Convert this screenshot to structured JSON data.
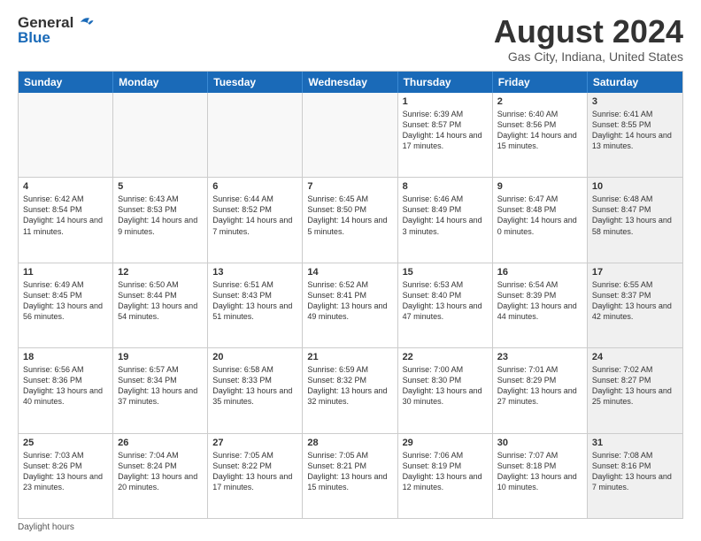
{
  "header": {
    "logo_general": "General",
    "logo_blue": "Blue",
    "title": "August 2024",
    "subtitle": "Gas City, Indiana, United States"
  },
  "days": [
    "Sunday",
    "Monday",
    "Tuesday",
    "Wednesday",
    "Thursday",
    "Friday",
    "Saturday"
  ],
  "weeks": [
    [
      {
        "num": "",
        "text": "",
        "empty": true
      },
      {
        "num": "",
        "text": "",
        "empty": true
      },
      {
        "num": "",
        "text": "",
        "empty": true
      },
      {
        "num": "",
        "text": "",
        "empty": true
      },
      {
        "num": "1",
        "text": "Sunrise: 6:39 AM\nSunset: 8:57 PM\nDaylight: 14 hours and 17 minutes.",
        "empty": false
      },
      {
        "num": "2",
        "text": "Sunrise: 6:40 AM\nSunset: 8:56 PM\nDaylight: 14 hours and 15 minutes.",
        "empty": false
      },
      {
        "num": "3",
        "text": "Sunrise: 6:41 AM\nSunset: 8:55 PM\nDaylight: 14 hours and 13 minutes.",
        "empty": false,
        "shaded": true
      }
    ],
    [
      {
        "num": "4",
        "text": "Sunrise: 6:42 AM\nSunset: 8:54 PM\nDaylight: 14 hours and 11 minutes.",
        "empty": false
      },
      {
        "num": "5",
        "text": "Sunrise: 6:43 AM\nSunset: 8:53 PM\nDaylight: 14 hours and 9 minutes.",
        "empty": false
      },
      {
        "num": "6",
        "text": "Sunrise: 6:44 AM\nSunset: 8:52 PM\nDaylight: 14 hours and 7 minutes.",
        "empty": false
      },
      {
        "num": "7",
        "text": "Sunrise: 6:45 AM\nSunset: 8:50 PM\nDaylight: 14 hours and 5 minutes.",
        "empty": false
      },
      {
        "num": "8",
        "text": "Sunrise: 6:46 AM\nSunset: 8:49 PM\nDaylight: 14 hours and 3 minutes.",
        "empty": false
      },
      {
        "num": "9",
        "text": "Sunrise: 6:47 AM\nSunset: 8:48 PM\nDaylight: 14 hours and 0 minutes.",
        "empty": false
      },
      {
        "num": "10",
        "text": "Sunrise: 6:48 AM\nSunset: 8:47 PM\nDaylight: 13 hours and 58 minutes.",
        "empty": false,
        "shaded": true
      }
    ],
    [
      {
        "num": "11",
        "text": "Sunrise: 6:49 AM\nSunset: 8:45 PM\nDaylight: 13 hours and 56 minutes.",
        "empty": false
      },
      {
        "num": "12",
        "text": "Sunrise: 6:50 AM\nSunset: 8:44 PM\nDaylight: 13 hours and 54 minutes.",
        "empty": false
      },
      {
        "num": "13",
        "text": "Sunrise: 6:51 AM\nSunset: 8:43 PM\nDaylight: 13 hours and 51 minutes.",
        "empty": false
      },
      {
        "num": "14",
        "text": "Sunrise: 6:52 AM\nSunset: 8:41 PM\nDaylight: 13 hours and 49 minutes.",
        "empty": false
      },
      {
        "num": "15",
        "text": "Sunrise: 6:53 AM\nSunset: 8:40 PM\nDaylight: 13 hours and 47 minutes.",
        "empty": false
      },
      {
        "num": "16",
        "text": "Sunrise: 6:54 AM\nSunset: 8:39 PM\nDaylight: 13 hours and 44 minutes.",
        "empty": false
      },
      {
        "num": "17",
        "text": "Sunrise: 6:55 AM\nSunset: 8:37 PM\nDaylight: 13 hours and 42 minutes.",
        "empty": false,
        "shaded": true
      }
    ],
    [
      {
        "num": "18",
        "text": "Sunrise: 6:56 AM\nSunset: 8:36 PM\nDaylight: 13 hours and 40 minutes.",
        "empty": false
      },
      {
        "num": "19",
        "text": "Sunrise: 6:57 AM\nSunset: 8:34 PM\nDaylight: 13 hours and 37 minutes.",
        "empty": false
      },
      {
        "num": "20",
        "text": "Sunrise: 6:58 AM\nSunset: 8:33 PM\nDaylight: 13 hours and 35 minutes.",
        "empty": false
      },
      {
        "num": "21",
        "text": "Sunrise: 6:59 AM\nSunset: 8:32 PM\nDaylight: 13 hours and 32 minutes.",
        "empty": false
      },
      {
        "num": "22",
        "text": "Sunrise: 7:00 AM\nSunset: 8:30 PM\nDaylight: 13 hours and 30 minutes.",
        "empty": false
      },
      {
        "num": "23",
        "text": "Sunrise: 7:01 AM\nSunset: 8:29 PM\nDaylight: 13 hours and 27 minutes.",
        "empty": false
      },
      {
        "num": "24",
        "text": "Sunrise: 7:02 AM\nSunset: 8:27 PM\nDaylight: 13 hours and 25 minutes.",
        "empty": false,
        "shaded": true
      }
    ],
    [
      {
        "num": "25",
        "text": "Sunrise: 7:03 AM\nSunset: 8:26 PM\nDaylight: 13 hours and 23 minutes.",
        "empty": false
      },
      {
        "num": "26",
        "text": "Sunrise: 7:04 AM\nSunset: 8:24 PM\nDaylight: 13 hours and 20 minutes.",
        "empty": false
      },
      {
        "num": "27",
        "text": "Sunrise: 7:05 AM\nSunset: 8:22 PM\nDaylight: 13 hours and 17 minutes.",
        "empty": false
      },
      {
        "num": "28",
        "text": "Sunrise: 7:05 AM\nSunset: 8:21 PM\nDaylight: 13 hours and 15 minutes.",
        "empty": false
      },
      {
        "num": "29",
        "text": "Sunrise: 7:06 AM\nSunset: 8:19 PM\nDaylight: 13 hours and 12 minutes.",
        "empty": false
      },
      {
        "num": "30",
        "text": "Sunrise: 7:07 AM\nSunset: 8:18 PM\nDaylight: 13 hours and 10 minutes.",
        "empty": false
      },
      {
        "num": "31",
        "text": "Sunrise: 7:08 AM\nSunset: 8:16 PM\nDaylight: 13 hours and 7 minutes.",
        "empty": false,
        "shaded": true
      }
    ]
  ],
  "footer": "Daylight hours"
}
